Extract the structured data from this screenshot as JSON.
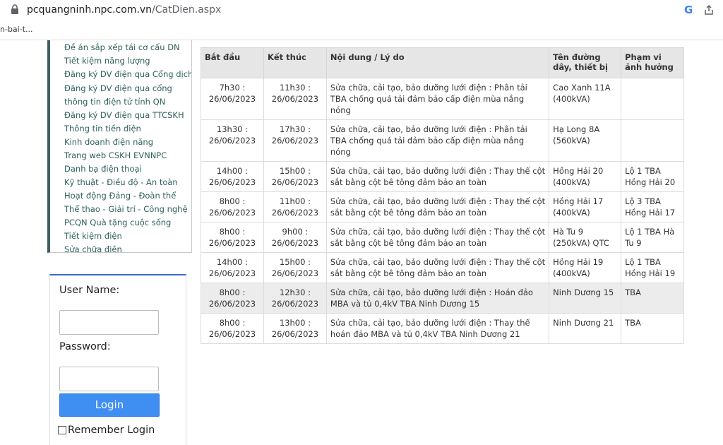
{
  "browser": {
    "url_host": "pcquangninh.npc.com.vn",
    "url_path": "/CatDien.aspx",
    "bookmark": "n-bai-t..."
  },
  "sidebar": {
    "items": [
      {
        "label": "Đề án sắp xếp tái cơ cấu DN"
      },
      {
        "label": "Tiết kiệm năng lượng"
      },
      {
        "label": "Đăng ký DV điện qua Cổng dịch vụ công quốc gia"
      },
      {
        "label": "Đăng ký DV điện qua cổng"
      },
      {
        "label": "thông tin điện tử tỉnh QN"
      },
      {
        "label": "Đăng ký DV điện qua TTCSKH"
      },
      {
        "label": "Thông tin tiền điện"
      },
      {
        "label": "Kinh doanh điện năng"
      },
      {
        "label": "Trang web CSKH EVNNPC"
      },
      {
        "label": "Danh bạ điện thoại"
      },
      {
        "label": "Kỹ thuật - Điều độ - An toàn"
      },
      {
        "label": "Hoạt động Đảng - Đoàn thể"
      },
      {
        "label": "Thể thao - Giải trí - Công nghệ"
      },
      {
        "label": "PCQN Quà tặng cuộc sống"
      },
      {
        "label": "Tiết kiệm điện"
      },
      {
        "label": "Sửa chữa điện"
      }
    ]
  },
  "login": {
    "username_label": "User Name:",
    "password_label": "Password:",
    "username_value": "",
    "password_value": "",
    "button": "Login",
    "remember": "Remember Login"
  },
  "table": {
    "headers": [
      "Bắt đầu",
      "Kết thúc",
      "Nội dung / Lý do",
      "Tên đường dây, thiết bị",
      "Phạm vi ảnh hưởng"
    ],
    "rows": [
      {
        "start": "7h30 : 26/06/2023",
        "end": "11h30 : 26/06/2023",
        "content": "Sửa chữa, cải tạo, bảo dưỡng lưới điện : Phân tải TBA chống quá tải đảm bảo cấp điện mùa nắng nóng",
        "line": "Cao Xanh 11A (400kVA)",
        "scope": ""
      },
      {
        "start": "13h30 : 26/06/2023",
        "end": "17h30 : 26/06/2023",
        "content": "Sửa chữa, cải tạo, bảo dưỡng lưới điện : Phân tải TBA chống quá tải đảm bảo cấp điện mùa nắng nóng",
        "line": "Hạ Long 8A (560kVA)",
        "scope": ""
      },
      {
        "start": "14h00 : 26/06/2023",
        "end": "15h00 : 26/06/2023",
        "content": "Sửa chữa, cải tạo, bảo dưỡng lưới điện : Thay thế cột sắt bằng cột bê tông đảm bảo an toàn",
        "line": "Hồng Hải 20 (400kVA)",
        "scope": "Lộ 1 TBA Hồng Hải 20"
      },
      {
        "start": "8h00 : 26/06/2023",
        "end": "11h00 : 26/06/2023",
        "content": "Sửa chữa, cải tạo, bảo dưỡng lưới điện : Thay thế cột sắt bằng cột bê tông đảm bảo an toàn",
        "line": "Hồng Hải 17 (400kVA)",
        "scope": "Lộ 3 TBA Hồng Hải 17"
      },
      {
        "start": "8h00 : 26/06/2023",
        "end": "9h00 : 26/06/2023",
        "content": "Sửa chữa, cải tạo, bảo dưỡng lưới điện : Thay thế cột sắt bằng cột bê tông đảm bảo an toàn",
        "line": "Hà Tu 9 (250kVA) QTC",
        "scope": "Lộ 1 TBA Hà Tu 9"
      },
      {
        "start": "14h00 : 26/06/2023",
        "end": "15h00 : 26/06/2023",
        "content": "Sửa chữa, cải tạo, bảo dưỡng lưới điện : Thay thế cột sắt bằng cột bê tông đảm bảo an toàn",
        "line": "Hồng Hải 19 (400kVA)",
        "scope": "Lộ 1 TBA Hồng Hải 19"
      },
      {
        "start": "8h00 : 26/06/2023",
        "end": "12h30 : 26/06/2023",
        "content": "Sửa chữa, cải tạo, bảo dưỡng lưới điện : Hoán đảo MBA và tủ 0,4kV TBA Ninh Dương 15",
        "line": "Ninh Dương 15",
        "scope": "TBA",
        "shaded": true
      },
      {
        "start": "8h00 : 26/06/2023",
        "end": "13h00 : 26/06/2023",
        "content": "Sửa chữa, cải tạo, bảo dưỡng lưới điện : Thay thế hoán đảo MBA và tủ 0,4kV TBA Ninh Dương 21",
        "line": "Ninh Dương 21",
        "scope": "TBA"
      }
    ]
  }
}
